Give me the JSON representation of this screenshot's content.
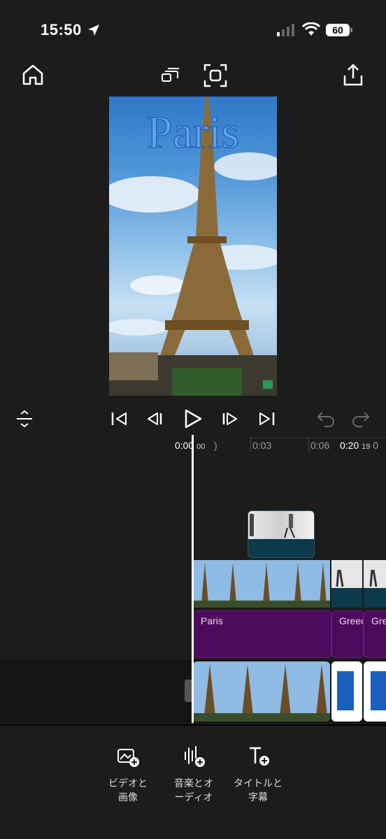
{
  "status_bar": {
    "time": "15:50",
    "battery": "60"
  },
  "player": {
    "preview_title": "Paris"
  },
  "timeline": {
    "current_time": "0:00",
    "current_frame": "00",
    "ruler_labels": [
      ")",
      "0:03",
      "0:06"
    ],
    "end_time": "0:20",
    "end_frame": "19",
    "end_overflow": "0"
  },
  "clips": {
    "titles": [
      "Paris",
      "Greece",
      "Greece"
    ]
  },
  "bottom_bar": {
    "tools": [
      {
        "label_line1": "ビデオと",
        "label_line2": "画像",
        "icon": "add-media-icon"
      },
      {
        "label_line1": "音楽とオ",
        "label_line2": "ーディオ",
        "icon": "add-audio-icon"
      },
      {
        "label_line1": "タイトルと",
        "label_line2": "字幕",
        "icon": "add-title-icon"
      }
    ]
  },
  "colors": {
    "background": "#1c1c1c",
    "title_track": "#4e0a5c",
    "video_track": "#0d3a4a"
  }
}
